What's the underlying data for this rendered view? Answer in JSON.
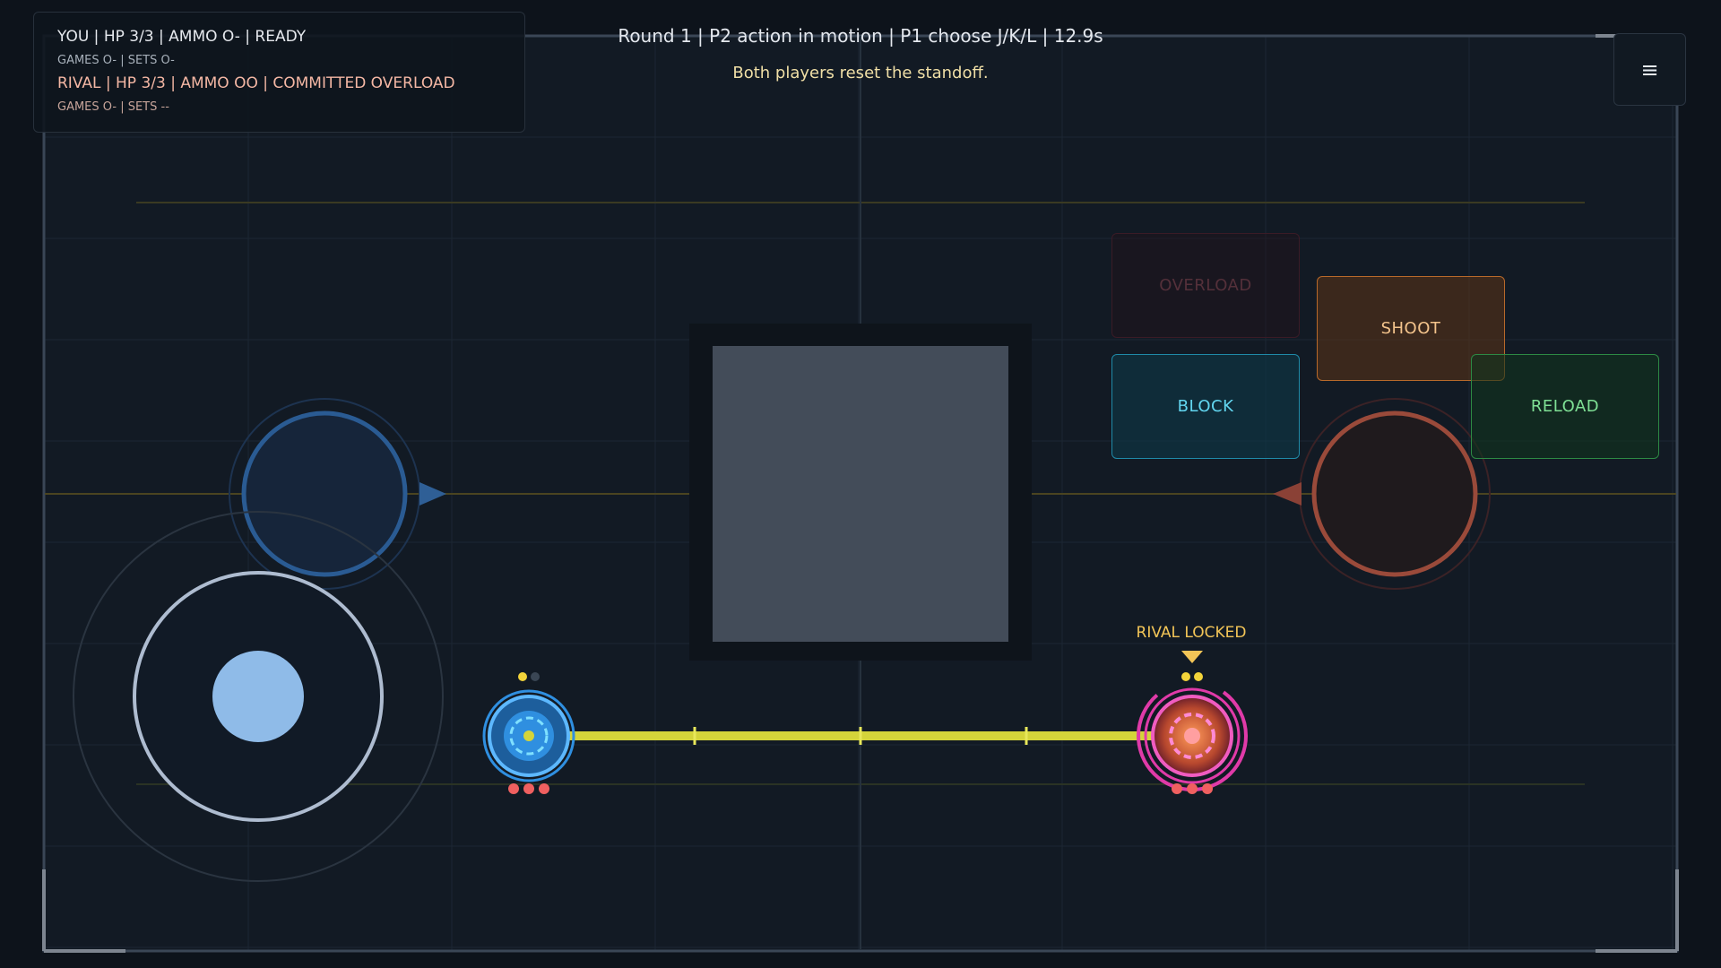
{
  "hud": {
    "you_line": "YOU | HP 3/3 | AMMO O- | READY",
    "you_meta": "GAMES O- | SETS O-",
    "rival_line": "RIVAL | HP 3/3 | AMMO OO | COMMITTED OVERLOAD",
    "rival_meta": "GAMES O- | SETS --"
  },
  "status": {
    "line": "Round 1 | P2 action in motion | P1 choose J/K/L | 12.9s",
    "event": "Both players reset the standoff."
  },
  "menu": {
    "icon": "hamburger-icon",
    "glyph": "≡"
  },
  "actions": {
    "overload": "OVERLOAD",
    "shoot": "SHOOT",
    "block": "BLOCK",
    "reload": "RELOAD"
  },
  "rival_tag": "RIVAL LOCKED",
  "game_state": {
    "player_hp": 3,
    "player_hp_max": 3,
    "player_ammo": 1,
    "player_ammo_max": 2,
    "rival_hp": 3,
    "rival_hp_max": 3,
    "rival_ammo": 2,
    "rival_ammo_max": 2
  },
  "colors": {
    "player": "#2f8fe0",
    "rival": "#e03aa8",
    "beam": "#d4d43a",
    "accent_yellow": "#f3c557"
  }
}
